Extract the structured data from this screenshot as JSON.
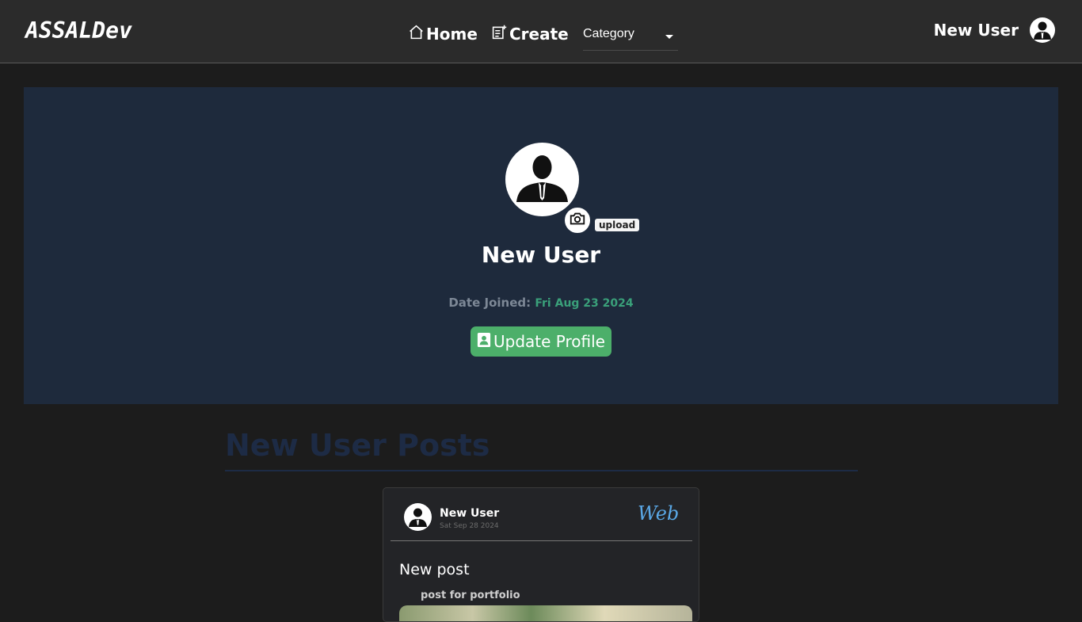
{
  "nav": {
    "brand": "ASSALDev",
    "home_label": "Home",
    "create_label": "Create",
    "category_label": "Category",
    "user_name": "New User"
  },
  "profile": {
    "name": "New User",
    "upload_label": "upload",
    "date_joined_label": "Date Joined:",
    "date_joined_value": "Fri Aug 23 2024",
    "update_button_label": "Update Profile"
  },
  "posts": {
    "section_title": "New User Posts",
    "items": [
      {
        "author": "New User",
        "date": "Sat Sep 28 2024",
        "category": "Web",
        "title": "New post",
        "description": "post for portfolio"
      }
    ]
  },
  "colors": {
    "navbar_bg": "#2b2b2b",
    "page_bg": "#1c1c1c",
    "profile_bg": "#1e2a3c",
    "accent_green": "#4caf6a",
    "date_value": "#3aa07a",
    "posts_title": "#1d2b45",
    "category_blue": "#5aa8e6"
  },
  "icons": {
    "home": "home-icon",
    "create": "create-post-icon",
    "user_avatar": "user-avatar-icon",
    "camera": "camera-icon",
    "profile_card": "contact-card-icon"
  }
}
